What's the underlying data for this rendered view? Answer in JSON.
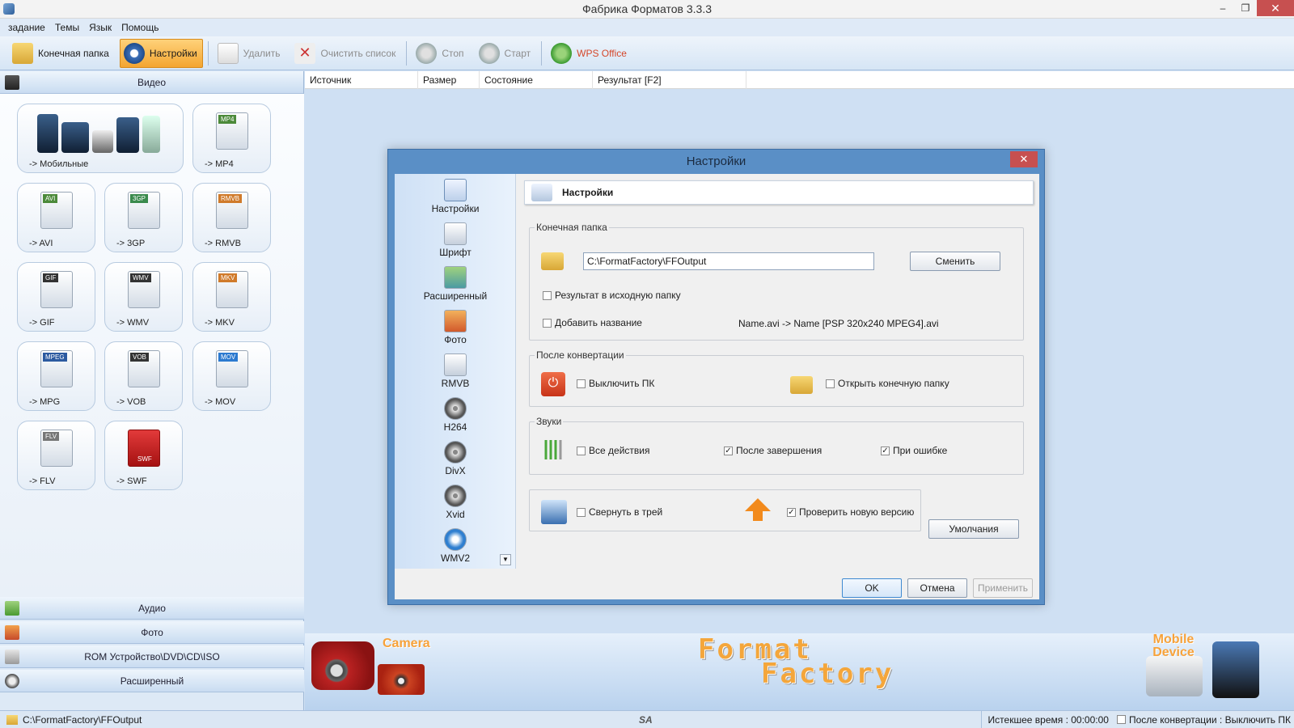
{
  "window": {
    "title": "Фабрика Форматов 3.3.3"
  },
  "menu": [
    "задание",
    "Темы",
    "Язык",
    "Помощь"
  ],
  "toolbar": {
    "output_folder": "Конечная папка",
    "settings": "Настройки",
    "delete": "Удалить",
    "clear_list": "Очистить список",
    "stop": "Стоп",
    "start": "Старт",
    "wps": "WPS Office"
  },
  "left": {
    "video": "Видео",
    "audio": "Аудио",
    "photo": "Фото",
    "rom": "ROM Устройство\\DVD\\CD\\ISO",
    "advanced": "Расширенный",
    "formats": [
      {
        "label": "-> Мобильные",
        "tag": ""
      },
      {
        "label": "-> MP4",
        "tag": "MP4"
      },
      {
        "label": "-> AVI",
        "tag": "AVI"
      },
      {
        "label": "-> 3GP",
        "tag": "3GP"
      },
      {
        "label": "-> RMVB",
        "tag": "RMVB"
      },
      {
        "label": "-> GIF",
        "tag": "GIF"
      },
      {
        "label": "-> WMV",
        "tag": "WMV"
      },
      {
        "label": "-> MKV",
        "tag": "MKV"
      },
      {
        "label": "-> MPG",
        "tag": "MPEG"
      },
      {
        "label": "-> VOB",
        "tag": "VOB"
      },
      {
        "label": "-> MOV",
        "tag": "MOV"
      },
      {
        "label": "-> FLV",
        "tag": "FLV"
      },
      {
        "label": "-> SWF",
        "tag": "SWF"
      }
    ]
  },
  "list_header": [
    "Источник",
    "Размер",
    "Состояние",
    "Результат [F2]"
  ],
  "banner": {
    "camera": "Camera",
    "brand1": "Format",
    "brand2": "Factory",
    "mobile": "Mobile Device"
  },
  "status": {
    "folder": "C:\\FormatFactory\\FFOutput",
    "sa": "SA",
    "elapsed": "Истекшее время : 00:00:00",
    "after": "После конвертации : Выключить ПК"
  },
  "dialog": {
    "title": "Настройки",
    "close": "✕",
    "nav": [
      "Настройки",
      "Шрифт",
      "Расширенный",
      "Фото",
      "RMVB",
      "H264",
      "DivX",
      "Xvid",
      "WMV2"
    ],
    "header": "Настройки",
    "output_group": "Конечная папка",
    "path": "C:\\FormatFactory\\FFOutput",
    "change": "Сменить",
    "to_source": "Результат в исходную папку",
    "add_name": "Добавить название",
    "name_example": "Name.avi  -> Name [PSP 320x240 MPEG4].avi",
    "after_group": "После конвертации",
    "shutdown": "Выключить ПК",
    "open_folder": "Открыть конечную папку",
    "sounds_group": "Звуки",
    "all_actions": "Все действия",
    "after_finish": "После завершения",
    "on_error": "При ошибке",
    "minimize": "Свернуть в трей",
    "check_update": "Проверить новую версию",
    "defaults": "Умолчания",
    "ok": "OK",
    "cancel": "Отмена",
    "apply": "Применить",
    "checks": {
      "to_source": false,
      "add_name": false,
      "shutdown": false,
      "open_folder": false,
      "all_actions": false,
      "after_finish": true,
      "on_error": true,
      "minimize": false,
      "check_update": true
    }
  }
}
